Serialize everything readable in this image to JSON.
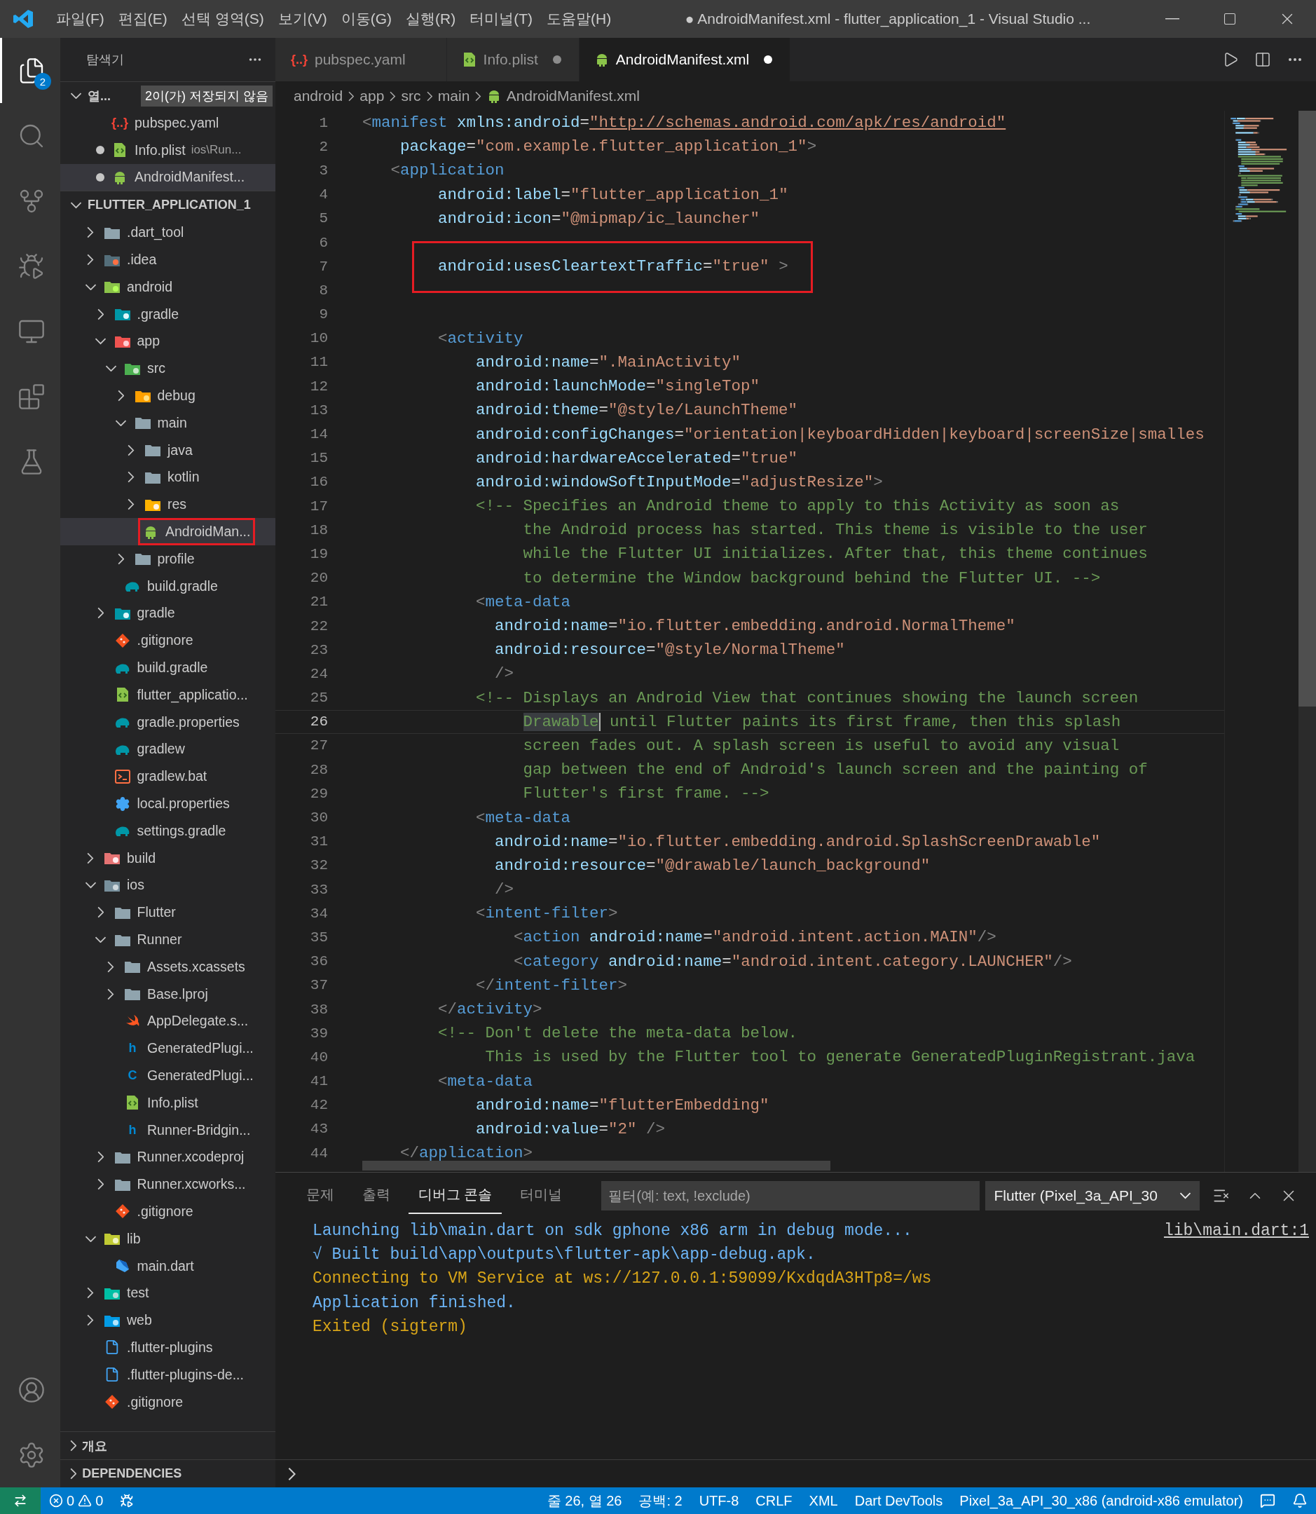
{
  "title_bar": {
    "menus": [
      "파일(F)",
      "편집(E)",
      "선택 영역(S)",
      "보기(V)",
      "이동(G)",
      "실행(R)",
      "터미널(T)",
      "도움말(H)"
    ],
    "title": "● AndroidManifest.xml - flutter_application_1 - Visual Studio ..."
  },
  "activity_bar": {
    "items": [
      {
        "kind": "explorer",
        "selected": true,
        "badge": "2"
      },
      {
        "kind": "search",
        "selected": false
      },
      {
        "kind": "source-control",
        "selected": false
      },
      {
        "kind": "run",
        "selected": false
      },
      {
        "kind": "remote",
        "selected": false
      },
      {
        "kind": "extensions",
        "selected": false
      },
      {
        "kind": "testing",
        "selected": false
      }
    ],
    "bottom": [
      {
        "kind": "account"
      },
      {
        "kind": "settings"
      }
    ]
  },
  "sidebar": {
    "title": "탐색기",
    "open_editors": {
      "label": "열...",
      "badge": "2이(가) 저장되지 않음",
      "expanded": true,
      "items": [
        {
          "name": "pubspec.yaml",
          "kind": "yaml",
          "glyph": "{..}",
          "dirty": false,
          "selected": false
        },
        {
          "name": "Info.plist",
          "description": "ios\\Run...",
          "kind": "code",
          "dirty": true,
          "selected": false
        },
        {
          "name": "AndroidManifest...",
          "kind": "android",
          "dirty": true,
          "selected": true
        }
      ]
    },
    "project": {
      "label": "FLUTTER_APPLICATION_1",
      "expanded": true,
      "tree": [
        {
          "name": ".dart_tool",
          "kind": "folder",
          "expanded": false,
          "selected": false
        },
        {
          "name": ".idea",
          "kind": "folder-idea",
          "expanded": false,
          "selected": false
        },
        {
          "name": "android",
          "kind": "folder-android",
          "expanded": true,
          "selected": false,
          "children": [
            {
              "name": ".gradle",
              "kind": "folder-gradle",
              "expanded": false,
              "selected": false
            },
            {
              "name": "app",
              "kind": "folder-app",
              "expanded": true,
              "selected": false,
              "children": [
                {
                  "name": "src",
                  "kind": "folder-src",
                  "expanded": true,
                  "selected": false,
                  "children": [
                    {
                      "name": "debug",
                      "kind": "folder-debug",
                      "expanded": false,
                      "selected": false
                    },
                    {
                      "name": "main",
                      "kind": "folder",
                      "expanded": true,
                      "selected": false,
                      "children": [
                        {
                          "name": "java",
                          "kind": "folder",
                          "expanded": false,
                          "selected": false
                        },
                        {
                          "name": "kotlin",
                          "kind": "folder",
                          "expanded": false,
                          "selected": false
                        },
                        {
                          "name": "res",
                          "kind": "folder-res",
                          "expanded": false,
                          "selected": false
                        },
                        {
                          "name": "AndroidMan...",
                          "kind": "android",
                          "selected": true,
                          "annotated": true
                        }
                      ]
                    },
                    {
                      "name": "profile",
                      "kind": "folder",
                      "expanded": false,
                      "selected": false
                    }
                  ]
                },
                {
                  "name": "build.gradle",
                  "kind": "gradle",
                  "selected": false
                }
              ]
            },
            {
              "name": "gradle",
              "kind": "folder-gradle",
              "expanded": false,
              "selected": false
            },
            {
              "name": ".gitignore",
              "kind": "git",
              "selected": false
            },
            {
              "name": "build.gradle",
              "kind": "gradle",
              "selected": false
            },
            {
              "name": "flutter_applicatio...",
              "kind": "code",
              "selected": false
            },
            {
              "name": "gradle.properties",
              "kind": "gradle",
              "selected": false
            },
            {
              "name": "gradlew",
              "kind": "gradle",
              "selected": false
            },
            {
              "name": "gradlew.bat",
              "kind": "bat",
              "selected": false
            },
            {
              "name": "local.properties",
              "kind": "settings",
              "selected": false
            },
            {
              "name": "settings.gradle",
              "kind": "gradle",
              "selected": false
            }
          ]
        },
        {
          "name": "build",
          "kind": "folder-build",
          "expanded": false,
          "selected": false
        },
        {
          "name": "ios",
          "kind": "folder-ios",
          "expanded": true,
          "selected": false,
          "children": [
            {
              "name": "Flutter",
              "kind": "folder",
              "expanded": false,
              "selected": false
            },
            {
              "name": "Runner",
              "kind": "folder",
              "expanded": true,
              "selected": false,
              "children": [
                {
                  "name": "Assets.xcassets",
                  "kind": "folder",
                  "expanded": false,
                  "selected": false
                },
                {
                  "name": "Base.lproj",
                  "kind": "folder",
                  "expanded": false,
                  "selected": false
                },
                {
                  "name": "AppDelegate.s...",
                  "kind": "swift",
                  "selected": false
                },
                {
                  "name": "GeneratedPlugi...",
                  "kind": "header",
                  "glyph": "h",
                  "selected": false
                },
                {
                  "name": "GeneratedPlugi...",
                  "kind": "c-source",
                  "glyph": "C",
                  "selected": false
                },
                {
                  "name": "Info.plist",
                  "kind": "code",
                  "selected": false
                },
                {
                  "name": "Runner-Bridgin...",
                  "kind": "header",
                  "glyph": "h",
                  "selected": false
                }
              ]
            },
            {
              "name": "Runner.xcodeproj",
              "kind": "folder",
              "expanded": false,
              "selected": false
            },
            {
              "name": "Runner.xcworks...",
              "kind": "folder",
              "expanded": false,
              "selected": false
            },
            {
              "name": ".gitignore",
              "kind": "git",
              "selected": false
            }
          ]
        },
        {
          "name": "lib",
          "kind": "folder-lib",
          "expanded": true,
          "selected": false,
          "children": [
            {
              "name": "main.dart",
              "kind": "dart",
              "selected": false
            }
          ]
        },
        {
          "name": "test",
          "kind": "folder-test",
          "expanded": false,
          "selected": false
        },
        {
          "name": "web",
          "kind": "folder-web",
          "expanded": false,
          "selected": false
        },
        {
          "name": ".flutter-plugins",
          "kind": "file",
          "selected": false
        },
        {
          "name": ".flutter-plugins-de...",
          "kind": "file",
          "selected": false
        },
        {
          "name": ".gitignore",
          "kind": "git",
          "selected": false
        }
      ]
    },
    "sections": [
      {
        "label": "개요",
        "expanded": false
      },
      {
        "label": "DEPENDENCIES",
        "expanded": false
      }
    ]
  },
  "tabs": [
    {
      "label": "pubspec.yaml",
      "kind": "yaml",
      "glyph": "{..}",
      "dirty": false,
      "selected": false
    },
    {
      "label": "Info.plist",
      "kind": "code",
      "dirty": true,
      "selected": false
    },
    {
      "label": "AndroidManifest.xml",
      "kind": "android",
      "dirty": true,
      "selected": true
    }
  ],
  "breadcrumb": [
    {
      "label": "android"
    },
    {
      "label": "app"
    },
    {
      "label": "src"
    },
    {
      "label": "main"
    },
    {
      "label": "AndroidManifest.xml",
      "kind": "android"
    }
  ],
  "editor": {
    "lines": [
      {
        "number": "1",
        "tokens": [
          {
            "kind": "punct",
            "text": "<"
          },
          {
            "kind": "tag",
            "text": "manifest"
          },
          {
            "kind": "attr",
            "text": " xmlns:android"
          },
          {
            "kind": "eq",
            "text": "="
          },
          {
            "kind": "link",
            "text": "\"http://schemas.android.com/apk/res/android\""
          }
        ]
      },
      {
        "number": "2",
        "tokens": [
          {
            "kind": "attr",
            "text": "    package"
          },
          {
            "kind": "eq",
            "text": "="
          },
          {
            "kind": "str",
            "text": "\"com.example.flutter_application_1\""
          },
          {
            "kind": "punct",
            "text": ">"
          }
        ]
      },
      {
        "number": "3",
        "tokens": [
          {
            "kind": "punct",
            "text": "   <"
          },
          {
            "kind": "tag",
            "text": "application"
          }
        ]
      },
      {
        "number": "4",
        "tokens": [
          {
            "kind": "attr",
            "text": "        android:label"
          },
          {
            "kind": "eq",
            "text": "="
          },
          {
            "kind": "str",
            "text": "\"flutter_application_1\""
          }
        ]
      },
      {
        "number": "5",
        "tokens": [
          {
            "kind": "attr",
            "text": "        android:icon"
          },
          {
            "kind": "eq",
            "text": "="
          },
          {
            "kind": "str",
            "text": "\"@mipmap/ic_launcher\""
          }
        ]
      },
      {
        "number": "6"
      },
      {
        "number": "7",
        "annotated": true,
        "tokens": [
          {
            "kind": "attr",
            "text": "        android:usesCleartextTraffic"
          },
          {
            "kind": "eq",
            "text": "="
          },
          {
            "kind": "str",
            "text": "\"true\""
          },
          {
            "kind": "punct",
            "text": " >"
          }
        ]
      },
      {
        "number": "8"
      },
      {
        "number": "9"
      },
      {
        "number": "10",
        "tokens": [
          {
            "kind": "punct",
            "text": "        <"
          },
          {
            "kind": "tag",
            "text": "activity"
          }
        ]
      },
      {
        "number": "11",
        "tokens": [
          {
            "kind": "attr",
            "text": "            android:name"
          },
          {
            "kind": "eq",
            "text": "="
          },
          {
            "kind": "str",
            "text": "\".MainActivity\""
          }
        ]
      },
      {
        "number": "12",
        "tokens": [
          {
            "kind": "attr",
            "text": "            android:launchMode"
          },
          {
            "kind": "eq",
            "text": "="
          },
          {
            "kind": "str",
            "text": "\"singleTop\""
          }
        ]
      },
      {
        "number": "13",
        "tokens": [
          {
            "kind": "attr",
            "text": "            android:theme"
          },
          {
            "kind": "eq",
            "text": "="
          },
          {
            "kind": "str",
            "text": "\"@style/LaunchTheme\""
          }
        ]
      },
      {
        "number": "14",
        "tokens": [
          {
            "kind": "attr",
            "text": "            android:configChanges"
          },
          {
            "kind": "eq",
            "text": "="
          },
          {
            "kind": "str",
            "text": "\"orientation|keyboardHidden|keyboard|screenSize|smalles"
          }
        ]
      },
      {
        "number": "15",
        "tokens": [
          {
            "kind": "attr",
            "text": "            android:hardwareAccelerated"
          },
          {
            "kind": "eq",
            "text": "="
          },
          {
            "kind": "str",
            "text": "\"true\""
          }
        ]
      },
      {
        "number": "16",
        "tokens": [
          {
            "kind": "attr",
            "text": "            android:windowSoftInputMode"
          },
          {
            "kind": "eq",
            "text": "="
          },
          {
            "kind": "str",
            "text": "\"adjustResize\""
          },
          {
            "kind": "punct",
            "text": ">"
          }
        ]
      },
      {
        "number": "17",
        "tokens": [
          {
            "kind": "comment",
            "text": "            <!-- Specifies an Android theme to apply to this Activity as soon as"
          }
        ]
      },
      {
        "number": "18",
        "tokens": [
          {
            "kind": "comment",
            "text": "                 the Android process has started. This theme is visible to the user"
          }
        ]
      },
      {
        "number": "19",
        "tokens": [
          {
            "kind": "comment",
            "text": "                 while the Flutter UI initializes. After that, this theme continues"
          }
        ]
      },
      {
        "number": "20",
        "tokens": [
          {
            "kind": "comment",
            "text": "                 to determine the Window background behind the Flutter UI. -->"
          }
        ]
      },
      {
        "number": "21",
        "tokens": [
          {
            "kind": "punct",
            "text": "            <"
          },
          {
            "kind": "tag",
            "text": "meta-data"
          }
        ]
      },
      {
        "number": "22",
        "tokens": [
          {
            "kind": "attr",
            "text": "              android:name"
          },
          {
            "kind": "eq",
            "text": "="
          },
          {
            "kind": "str",
            "text": "\"io.flutter.embedding.android.NormalTheme\""
          }
        ]
      },
      {
        "number": "23",
        "tokens": [
          {
            "kind": "attr",
            "text": "              android:resource"
          },
          {
            "kind": "eq",
            "text": "="
          },
          {
            "kind": "str",
            "text": "\"@style/NormalTheme\""
          }
        ]
      },
      {
        "number": "24",
        "tokens": [
          {
            "kind": "punct",
            "text": "              />"
          }
        ]
      },
      {
        "number": "25",
        "tokens": [
          {
            "kind": "comment",
            "text": "            <!-- Displays an Android View that continues showing the launch screen"
          }
        ]
      },
      {
        "number": "26",
        "current": true,
        "tokens": [
          {
            "kind": "match",
            "text": "                 Drawable"
          },
          {
            "kind": "comment",
            "text": " until Flutter paints its first frame, then this splash"
          }
        ]
      },
      {
        "number": "27",
        "tokens": [
          {
            "kind": "comment",
            "text": "                 screen fades out. A splash screen is useful to avoid any visual"
          }
        ]
      },
      {
        "number": "28",
        "tokens": [
          {
            "kind": "comment",
            "text": "                 gap between the end of Android's launch screen and the painting of"
          }
        ]
      },
      {
        "number": "29",
        "tokens": [
          {
            "kind": "comment",
            "text": "                 Flutter's first frame. -->"
          }
        ]
      },
      {
        "number": "30",
        "tokens": [
          {
            "kind": "punct",
            "text": "            <"
          },
          {
            "kind": "tag",
            "text": "meta-data"
          }
        ]
      },
      {
        "number": "31",
        "tokens": [
          {
            "kind": "attr",
            "text": "              android:name"
          },
          {
            "kind": "eq",
            "text": "="
          },
          {
            "kind": "str",
            "text": "\"io.flutter.embedding.android.SplashScreenDrawable\""
          }
        ]
      },
      {
        "number": "32",
        "tokens": [
          {
            "kind": "attr",
            "text": "              android:resource"
          },
          {
            "kind": "eq",
            "text": "="
          },
          {
            "kind": "str",
            "text": "\"@drawable/launch_background\""
          }
        ]
      },
      {
        "number": "33",
        "tokens": [
          {
            "kind": "punct",
            "text": "              />"
          }
        ]
      },
      {
        "number": "34",
        "tokens": [
          {
            "kind": "punct",
            "text": "            <"
          },
          {
            "kind": "tag",
            "text": "intent-filter"
          },
          {
            "kind": "punct",
            "text": ">"
          }
        ]
      },
      {
        "number": "35",
        "tokens": [
          {
            "kind": "punct",
            "text": "                <"
          },
          {
            "kind": "tag",
            "text": "action"
          },
          {
            "kind": "attr",
            "text": " android:name"
          },
          {
            "kind": "eq",
            "text": "="
          },
          {
            "kind": "str",
            "text": "\"android.intent.action.MAIN\""
          },
          {
            "kind": "punct",
            "text": "/>"
          }
        ]
      },
      {
        "number": "36",
        "tokens": [
          {
            "kind": "punct",
            "text": "                <"
          },
          {
            "kind": "tag",
            "text": "category"
          },
          {
            "kind": "attr",
            "text": " android:name"
          },
          {
            "kind": "eq",
            "text": "="
          },
          {
            "kind": "str",
            "text": "\"android.intent.category.LAUNCHER\""
          },
          {
            "kind": "punct",
            "text": "/>"
          }
        ]
      },
      {
        "number": "37",
        "tokens": [
          {
            "kind": "punct",
            "text": "            </"
          },
          {
            "kind": "tag",
            "text": "intent-filter"
          },
          {
            "kind": "punct",
            "text": ">"
          }
        ]
      },
      {
        "number": "38",
        "tokens": [
          {
            "kind": "punct",
            "text": "        </"
          },
          {
            "kind": "tag",
            "text": "activity"
          },
          {
            "kind": "punct",
            "text": ">"
          }
        ]
      },
      {
        "number": "39",
        "tokens": [
          {
            "kind": "comment",
            "text": "        <!-- Don't delete the meta-data below."
          }
        ]
      },
      {
        "number": "40",
        "tokens": [
          {
            "kind": "comment",
            "text": "             This is used by the Flutter tool to generate GeneratedPluginRegistrant.java"
          }
        ]
      },
      {
        "number": "41",
        "tokens": [
          {
            "kind": "punct",
            "text": "        <"
          },
          {
            "kind": "tag",
            "text": "meta-data"
          }
        ]
      },
      {
        "number": "42",
        "tokens": [
          {
            "kind": "attr",
            "text": "            android:name"
          },
          {
            "kind": "eq",
            "text": "="
          },
          {
            "kind": "str",
            "text": "\"flutterEmbedding\""
          }
        ]
      },
      {
        "number": "43",
        "tokens": [
          {
            "kind": "attr",
            "text": "            android:value"
          },
          {
            "kind": "eq",
            "text": "="
          },
          {
            "kind": "str",
            "text": "\"2\""
          },
          {
            "kind": "punct",
            "text": " />"
          }
        ]
      },
      {
        "number": "44",
        "tokens": [
          {
            "kind": "punct",
            "text": "    </"
          },
          {
            "kind": "tag",
            "text": "application"
          },
          {
            "kind": "punct",
            "text": ">"
          }
        ]
      }
    ]
  },
  "panel": {
    "tabs": [
      {
        "label": "문제",
        "selected": false
      },
      {
        "label": "출력",
        "selected": false
      },
      {
        "label": "디버그 콘솔",
        "selected": true
      },
      {
        "label": "터미널",
        "selected": false
      }
    ],
    "filter": {
      "placeholder": "필터(예: text, !exclude)"
    },
    "session": "Flutter (Pixel_3a_API_30",
    "output": [
      {
        "kind": "info",
        "text": "Launching lib\\main.dart on sdk gphone x86 arm in debug mode...",
        "source": "lib\\main.dart:1"
      },
      {
        "kind": "info",
        "text": "√ Built build\\app\\outputs\\flutter-apk\\app-debug.apk."
      },
      {
        "kind": "warn",
        "text": "Connecting to VM Service at ws://127.0.0.1:59099/KxdqdA3HTp8=/ws"
      },
      {
        "kind": "info",
        "text": "Application finished."
      },
      {
        "kind": "warn",
        "text": "Exited (sigterm)"
      }
    ]
  },
  "status_bar": {
    "errors": "0",
    "warnings": "0",
    "items": [
      "줄 26, 열 26",
      "공백: 2",
      "UTF-8",
      "CRLF",
      "XML",
      "Dart DevTools",
      "Pixel_3a_API_30_x86 (android-x86 emulator)"
    ]
  }
}
